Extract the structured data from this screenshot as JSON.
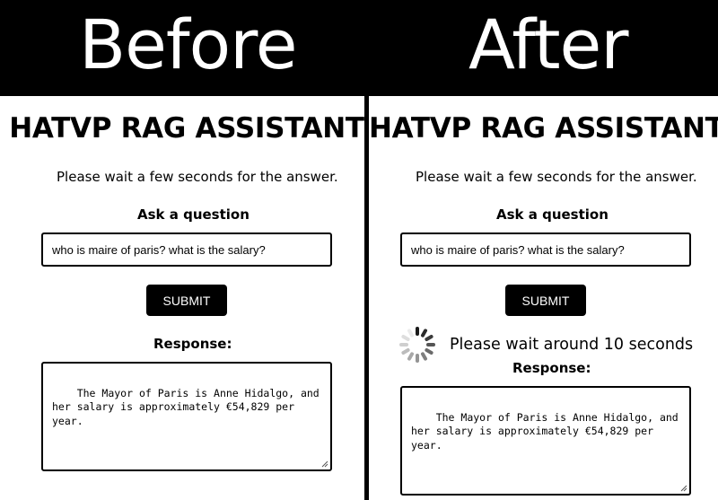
{
  "header": {
    "before_label": "Before",
    "after_label": "After"
  },
  "app": {
    "title": "HATVP RAG ASSISTANT",
    "subtitle": "Please wait a few seconds for the answer.",
    "ask_label": "Ask a question",
    "question_value": "who is maire of paris? what is the salary?",
    "submit_label": "SUBMIT",
    "response_label": "Response:",
    "response_text": "The Mayor of Paris is Anne Hidalgo, and\nher salary is approximately €54,829 per\nyear."
  },
  "loading": {
    "text": "Please wait around 10 seconds",
    "icon": "spinner-icon"
  },
  "colors": {
    "background": "#000000",
    "panel": "#ffffff",
    "button": "#000000",
    "button_text": "#ffffff"
  }
}
